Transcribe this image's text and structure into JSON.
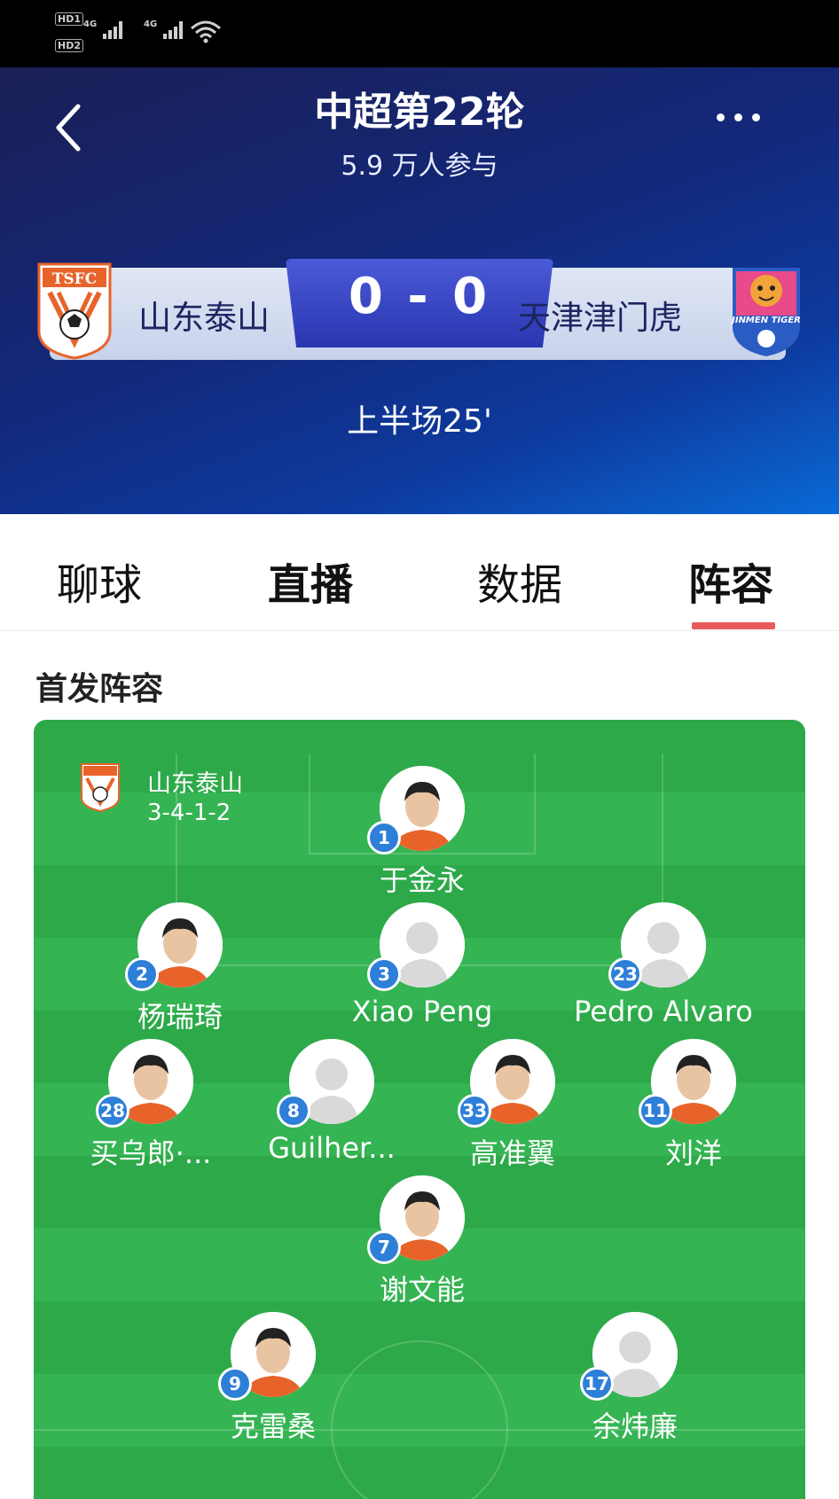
{
  "status_bar": {
    "sim1": "HD1",
    "sim2": "HD2",
    "net1": "4G",
    "net2": "4G"
  },
  "header": {
    "title": "中超第22轮",
    "participants": "5.9 万人参与",
    "home_team": "山东泰山",
    "away_team": "天津津门虎",
    "score": "0 - 0",
    "match_time": "上半场25'",
    "home_crest_text": "TSFC",
    "away_crest_text": "JINMEN TIGER"
  },
  "tabs": [
    {
      "label": "聊球"
    },
    {
      "label": "直播"
    },
    {
      "label": "数据"
    },
    {
      "label": "阵容",
      "active": true
    }
  ],
  "lineup": {
    "section_title": "首发阵容",
    "team": "山东泰山",
    "formation": "3-4-1-2",
    "players": [
      {
        "number": "1",
        "name": "于金永",
        "photo": true
      },
      {
        "number": "2",
        "name": "杨瑞琦",
        "photo": true
      },
      {
        "number": "3",
        "name": "Xiao Peng",
        "photo": false
      },
      {
        "number": "23",
        "name": "Pedro Alvaro",
        "photo": false
      },
      {
        "number": "28",
        "name": "买乌郎·...",
        "photo": true
      },
      {
        "number": "8",
        "name": "Guilher...",
        "photo": false
      },
      {
        "number": "33",
        "name": "高准翼",
        "photo": true
      },
      {
        "number": "11",
        "name": "刘洋",
        "photo": true
      },
      {
        "number": "7",
        "name": "谢文能",
        "photo": true
      },
      {
        "number": "9",
        "name": "克雷桑",
        "photo": true
      },
      {
        "number": "17",
        "name": "余炜廉",
        "photo": false
      }
    ]
  },
  "colors": {
    "accent_underline": "#e85a5a",
    "number_badge": "#2e7fd8",
    "pitch_green": "#2ea94a",
    "home_orange": "#e8632a"
  }
}
